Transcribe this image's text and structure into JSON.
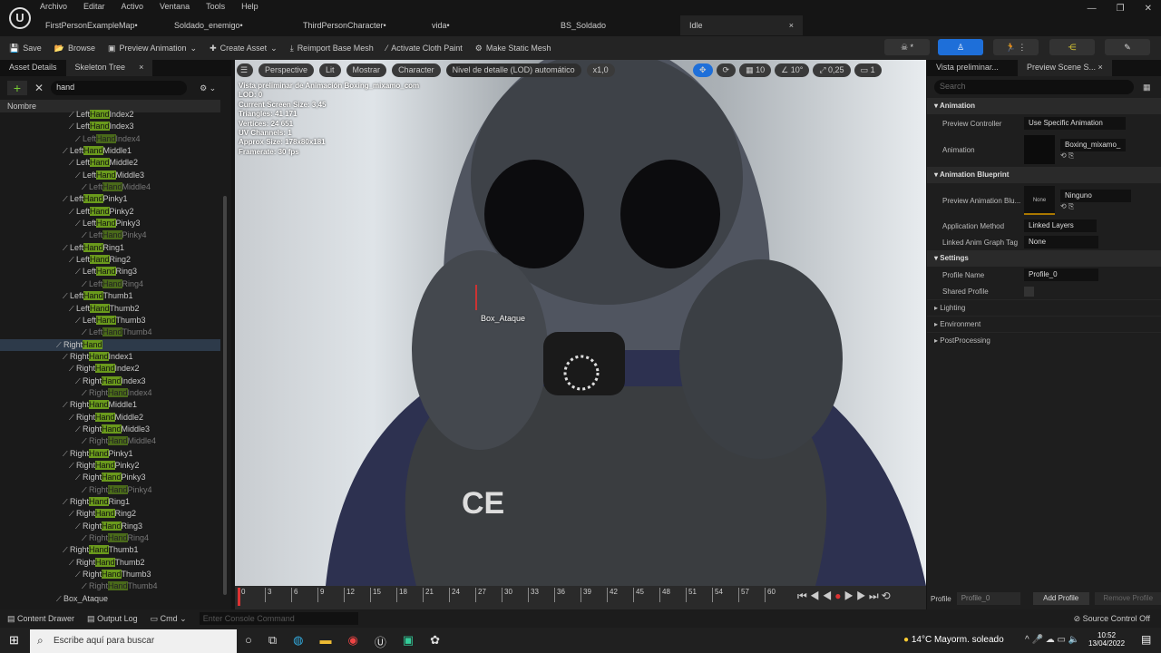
{
  "menu": [
    "Archivo",
    "Editar",
    "Activo",
    "Ventana",
    "Tools",
    "Help"
  ],
  "tabs": [
    {
      "label": "FirstPersonExampleMap•"
    },
    {
      "label": "Soldado_enemigo•"
    },
    {
      "label": "ThirdPersonCharacter•"
    },
    {
      "label": "vida•"
    },
    {
      "label": "BS_Soldado"
    },
    {
      "label": "Idle",
      "active": true
    }
  ],
  "toolbar": [
    "Save",
    "Browse",
    "Preview Animation",
    "Create Asset",
    "Reimport Base Mesh",
    "Activate Cloth Paint",
    "Make Static Mesh"
  ],
  "accent": "#1e6fd9",
  "left": {
    "tabs": [
      "Asset Details",
      "Skeleton Tree"
    ],
    "search": "hand",
    "column": "Nombre",
    "rows": [
      [
        "LeftHandIndex2",
        4,
        0
      ],
      [
        "LeftHandIndex3",
        4,
        0
      ],
      [
        "LeftHandIndex4",
        5,
        1
      ],
      [
        "LeftHandMiddle1",
        3,
        0
      ],
      [
        "LeftHandMiddle2",
        4,
        0
      ],
      [
        "LeftHandMiddle3",
        5,
        0
      ],
      [
        "LeftHandMiddle4",
        6,
        1
      ],
      [
        "LeftHandPinky1",
        3,
        0
      ],
      [
        "LeftHandPinky2",
        4,
        0
      ],
      [
        "LeftHandPinky3",
        5,
        0
      ],
      [
        "LeftHandPinky4",
        6,
        1
      ],
      [
        "LeftHandRing1",
        3,
        0
      ],
      [
        "LeftHandRing2",
        4,
        0
      ],
      [
        "LeftHandRing3",
        5,
        0
      ],
      [
        "LeftHandRing4",
        6,
        1
      ],
      [
        "LeftHandThumb1",
        3,
        0
      ],
      [
        "LeftHandThumb2",
        4,
        0
      ],
      [
        "LeftHandThumb3",
        5,
        0
      ],
      [
        "LeftHandThumb4",
        6,
        1
      ],
      [
        "RightHand",
        2,
        0
      ],
      [
        "RightHandIndex1",
        3,
        0
      ],
      [
        "RightHandIndex2",
        4,
        0
      ],
      [
        "RightHandIndex3",
        5,
        0
      ],
      [
        "RightHandIndex4",
        6,
        1
      ],
      [
        "RightHandMiddle1",
        3,
        0
      ],
      [
        "RightHandMiddle2",
        4,
        0
      ],
      [
        "RightHandMiddle3",
        5,
        0
      ],
      [
        "RightHandMiddle4",
        6,
        1
      ],
      [
        "RightHandPinky1",
        3,
        0
      ],
      [
        "RightHandPinky2",
        4,
        0
      ],
      [
        "RightHandPinky3",
        5,
        0
      ],
      [
        "RightHandPinky4",
        6,
        1
      ],
      [
        "RightHandRing1",
        3,
        0
      ],
      [
        "RightHandRing2",
        4,
        0
      ],
      [
        "RightHandRing3",
        5,
        0
      ],
      [
        "RightHandRing4",
        6,
        1
      ],
      [
        "RightHandThumb1",
        3,
        0
      ],
      [
        "RightHandThumb2",
        4,
        0
      ],
      [
        "RightHandThumb3",
        5,
        0
      ],
      [
        "RightHandThumb4",
        6,
        1
      ],
      [
        "Box_Ataque",
        2,
        0
      ]
    ],
    "selected": "RightHand"
  },
  "viewport": {
    "pills": [
      "Perspective",
      "Lit",
      "Mostrar",
      "Character",
      "Nivel de detalle (LOD) automático",
      "x1,0"
    ],
    "grid": "10",
    "angle": "10°",
    "scale": "0,25",
    "camera": "1",
    "stats": [
      "Vista preliminar de Animación Boxing_mixamo_com",
      "LOD: 0",
      "Current Screen Size: 3,45",
      "Triangles: 41 171",
      "Vertices: 24 651",
      "UV Channels: 1",
      "Approx Size: 178x80x181",
      "Framerate: 30 fps"
    ],
    "socket": "Box_Ataque"
  },
  "timeline": [
    "0",
    "3",
    "6",
    "9",
    "12",
    "15",
    "18",
    "21",
    "24",
    "27",
    "30",
    "33",
    "36",
    "39",
    "42",
    "45",
    "48",
    "51",
    "54",
    "57",
    "60"
  ],
  "right": {
    "tabs": [
      "Vista preliminar...",
      "Preview Scene S..."
    ],
    "search_placeholder": "Search",
    "animation": {
      "title": "Animation",
      "preview_controller_label": "Preview Controller",
      "preview_controller": "Use Specific Animation",
      "animation_label": "Animation",
      "animation": "Boxing_mixamo_"
    },
    "blueprint": {
      "title": "Animation Blueprint",
      "label": "Preview Animation Blu...",
      "thumb": "None",
      "value": "Ninguno",
      "method_label": "Application Method",
      "method": "Linked Layers",
      "tag_label": "Linked Anim Graph Tag",
      "tag": "None"
    },
    "settings": {
      "title": "Settings",
      "profile_label": "Profile Name",
      "profile": "Profile_0",
      "shared_label": "Shared Profile"
    },
    "collapsed": [
      "Lighting",
      "Environment",
      "PostProcessing"
    ],
    "profile_label": "Profile",
    "profile_value": "Profile_0",
    "add": "Add Profile",
    "remove": "Remove Profile"
  },
  "status": {
    "content_drawer": "Content Drawer",
    "output_log": "Output Log",
    "cmd": "Cmd",
    "console_placeholder": "Enter Console Command",
    "source_control": "Source Control Off"
  },
  "taskbar": {
    "search": "Escribe aquí para buscar",
    "weather": "14°C  Mayorm. soleado",
    "time": "10:52",
    "date": "13/04/2022"
  }
}
